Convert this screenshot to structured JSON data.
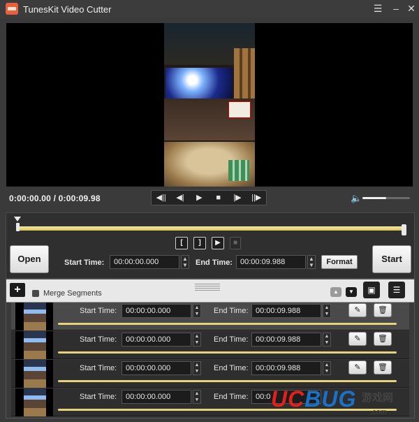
{
  "window": {
    "title": "TunesKit Video Cutter",
    "menu_icon": "list-icon",
    "minimize": "–",
    "close": "✕"
  },
  "player": {
    "current_time": "0:00:00.00",
    "total_time": "0:00:09.98",
    "time_separator": " / ",
    "volume_level": 0.5,
    "controls": [
      {
        "name": "prev-segment-icon",
        "glyph": "◀||"
      },
      {
        "name": "step-back-icon",
        "glyph": "◀|"
      },
      {
        "name": "play-icon",
        "glyph": "▶"
      },
      {
        "name": "stop-icon",
        "glyph": "■"
      },
      {
        "name": "step-forward-icon",
        "glyph": "|▶"
      },
      {
        "name": "next-segment-icon",
        "glyph": "||▶"
      }
    ]
  },
  "editor": {
    "open_label": "Open",
    "start_label": "Start",
    "start_time_label": "Start Time:",
    "start_time_value": "00:00:00.000",
    "end_time_label": "End Time:",
    "end_time_value": "00:00:09.988",
    "format_label": "Format",
    "mark_in": "[",
    "mark_out": "]",
    "play_segment": "▶"
  },
  "segment_list": {
    "add_label": "+",
    "merge_label": "Merge Segments",
    "segments": [
      {
        "start_label": "Start Time:",
        "start": "00:00:00.000",
        "end_label": "End Time:",
        "end": "00:00:09.988",
        "selected": true
      },
      {
        "start_label": "Start Time:",
        "start": "00:00:00.000",
        "end_label": "End Time:",
        "end": "00:00:09.988",
        "selected": false
      },
      {
        "start_label": "Start Time:",
        "start": "00:00:00.000",
        "end_label": "End Time:",
        "end": "00:00:09.988",
        "selected": false
      },
      {
        "start_label": "Start Time:",
        "start": "00:00:00.000",
        "end_label": "End Time:",
        "end": "00:0",
        "selected": false
      }
    ]
  },
  "watermark": {
    "uc": "UC",
    "bug": "BUG",
    "sub": "游戏网",
    "domain": ".com"
  },
  "colors": {
    "accent_timeline": "#e6d27a",
    "watermark_red": "#e2211c",
    "watermark_blue": "#1a72c8"
  }
}
